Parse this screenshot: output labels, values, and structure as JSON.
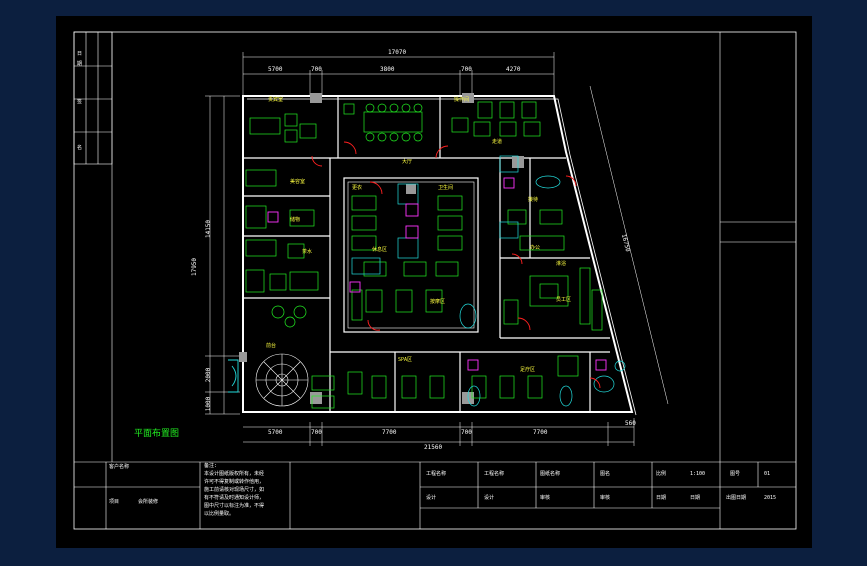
{
  "drawing": {
    "title": "平面布置图",
    "colors": {
      "background": "#0c1f3f",
      "canvas": "#000000",
      "wall": "#ffffff",
      "furniture": "#22ee22",
      "fixture": "#22dddd",
      "label": "#ffff40",
      "door": "#ff2020",
      "accent": "#ff33ff"
    }
  },
  "dimensions": {
    "top_total": "17070",
    "top_1": "5700",
    "top_2": "700",
    "top_3": "3800",
    "top_4": "700",
    "top_5": "4270",
    "bottom_total": "21560",
    "bottom_1": "5700",
    "bottom_2": "700",
    "bottom_3": "7700",
    "bottom_4": "700",
    "bottom_5": "7700",
    "bottom_6": "560",
    "left_total": "17950",
    "left_1": "14150",
    "left_2": "2000",
    "left_3": "1000",
    "right_diag": "16750"
  },
  "rooms": {
    "r1": "大厅",
    "r2": "贵宾室",
    "r3": "走道",
    "r4": "美容室",
    "r5": "储物",
    "r6": "SPA区",
    "r7": "休息区",
    "r8": "接待",
    "r9": "卫生间",
    "r10": "更衣",
    "r11": "茶水",
    "r12": "员工区",
    "r13": "淋浴",
    "r14": "按摩区",
    "r15": "足疗区",
    "r16": "操作间",
    "r17": "办公",
    "r18": "前台"
  },
  "left_strip": {
    "a": "日",
    "b": "期",
    "c": "签",
    "d": "名"
  },
  "title_block": {
    "client_label": "客户名称",
    "notes_label": "备注:",
    "project_label": "项目",
    "project_value": "会所装修",
    "notes_lines": [
      "本设计图纸版权所有，未经",
      "许可不得复制或转作他用，",
      "施工前请核对现场尺寸，如",
      "有不符请及时通知设计师，",
      "图中尺寸以标注为准，不得",
      "以比例量取。"
    ],
    "cells": {
      "c1": "工程名称",
      "c2": "工程名称",
      "c3": "图纸名称",
      "c4": "图名",
      "c5": "比例",
      "c6": "1:100",
      "c7": "图号",
      "c8": "01",
      "c9": "设计",
      "c10": "设计",
      "c11": "审核",
      "c12": "审核",
      "c13": "日期",
      "c14": "日期",
      "c15": "出图日期",
      "c16": "2015"
    }
  }
}
